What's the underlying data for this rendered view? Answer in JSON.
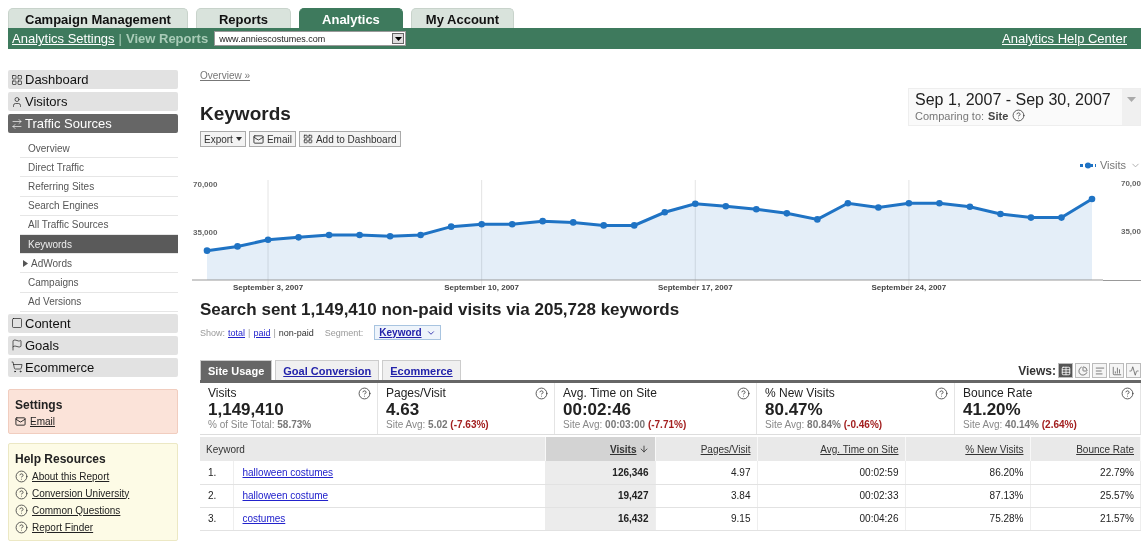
{
  "top_tabs": [
    {
      "label": "Campaign Management",
      "selected": false
    },
    {
      "label": "Reports",
      "selected": false
    },
    {
      "label": "Analytics",
      "selected": true
    },
    {
      "label": "My Account",
      "selected": false
    }
  ],
  "subnav": {
    "settings_link": "Analytics Settings",
    "separator": "|",
    "view_reports": "View Reports",
    "site_select": "www.anniescostumes.com",
    "help_link": "Analytics Help Center"
  },
  "sidebar": {
    "sections": [
      {
        "label": "Dashboard",
        "selected": false
      },
      {
        "label": "Visitors",
        "selected": false
      },
      {
        "label": "Traffic Sources",
        "selected": true,
        "children": [
          {
            "label": "Overview",
            "selected": false,
            "kind": "link"
          },
          {
            "label": "Direct Traffic",
            "selected": false,
            "kind": "link"
          },
          {
            "label": "Referring Sites",
            "selected": false,
            "kind": "link"
          },
          {
            "label": "Search Engines",
            "selected": false,
            "kind": "link"
          },
          {
            "label": "All Traffic Sources",
            "selected": false,
            "kind": "link"
          },
          {
            "label": "Keywords",
            "selected": true,
            "kind": "link"
          },
          {
            "label": "AdWords",
            "selected": false,
            "kind": "group"
          },
          {
            "label": "Campaigns",
            "selected": false,
            "kind": "link"
          },
          {
            "label": "Ad Versions",
            "selected": false,
            "kind": "link"
          }
        ]
      },
      {
        "label": "Content",
        "selected": false
      },
      {
        "label": "Goals",
        "selected": false
      },
      {
        "label": "Ecommerce",
        "selected": false
      }
    ],
    "settings_box": {
      "title": "Settings",
      "links": [
        "Email"
      ]
    },
    "help_box": {
      "title": "Help Resources",
      "links": [
        "About this Report",
        "Conversion University",
        "Common Questions",
        "Report Finder"
      ]
    }
  },
  "main": {
    "breadcrumb": "Overview »",
    "title": "Keywords",
    "actions": [
      {
        "label": "Export",
        "kind": "menu"
      },
      {
        "label": "Email",
        "kind": "email"
      },
      {
        "label": "Add to Dashboard",
        "kind": "dashboard"
      }
    ],
    "date_range": {
      "range": "Sep 1, 2007 - Sep 30, 2007",
      "comparing_label": "Comparing to:",
      "comparing_value": "Site"
    },
    "chart": {
      "right_tick_labels": [
        "70,00",
        "35,00"
      ],
      "chart_data": {
        "type": "area",
        "categories": [
          null,
          null,
          "September 3, 2007",
          null,
          null,
          null,
          null,
          null,
          null,
          "September 10, 2007",
          null,
          null,
          null,
          null,
          null,
          null,
          "September 17, 2007",
          null,
          null,
          null,
          null,
          null,
          null,
          "September 24, 2007",
          null,
          null,
          null,
          null,
          null,
          null
        ],
        "series": [
          {
            "name": "Visits",
            "color": "#1f73c4",
            "values": [
              21400,
              24500,
              29300,
              31100,
              32800,
              32800,
              31900,
              32800,
              38900,
              40700,
              40700,
              42900,
              42000,
              39800,
              39800,
              49400,
              55600,
              53800,
              51600,
              48600,
              44200,
              56000,
              52900,
              56000,
              56000,
              53400,
              48100,
              45500,
              45500,
              59100
            ]
          }
        ],
        "ylim": [
          0,
          70000
        ],
        "grid": true,
        "yticks": [
          {
            "value": 35000,
            "label": "35,000"
          },
          {
            "value": 70000,
            "label": "70,000"
          }
        ]
      }
    },
    "headline": "Search sent 1,149,410 non-paid visits via 205,728 keywords",
    "show": {
      "label": "Show:",
      "separator": "|",
      "options": [
        {
          "label": "total",
          "selected": false
        },
        {
          "label": "paid",
          "selected": false
        },
        {
          "label": "non-paid",
          "selected": true
        }
      ]
    },
    "segment": {
      "label": "Segment:",
      "value": "Keyword"
    },
    "report_tabs": [
      {
        "label": "Site Usage",
        "selected": true
      },
      {
        "label": "Goal Conversion",
        "selected": false
      },
      {
        "label": "Ecommerce",
        "selected": false
      }
    ],
    "views": {
      "label": "Views:",
      "options": [
        {
          "selected": true
        },
        {
          "selected": false
        },
        {
          "selected": false
        },
        {
          "selected": false
        },
        {
          "selected": false
        }
      ]
    },
    "metrics": [
      {
        "name": "Visits",
        "value": "1,149,410",
        "note_label": "% of Site Total:",
        "note_value": "58.73%"
      },
      {
        "name": "Pages/Visit",
        "value": "4.63",
        "note_label": "Site Avg:",
        "note_value": "5.02",
        "delta": "(-7.63%)"
      },
      {
        "name": "Avg. Time on Site",
        "value": "00:02:46",
        "note_label": "Site Avg:",
        "note_value": "00:03:00",
        "delta": "(-7.71%)"
      },
      {
        "name": "% New Visits",
        "value": "80.47%",
        "note_label": "Site Avg:",
        "note_value": "80.84%",
        "delta": "(-0.46%)"
      },
      {
        "name": "Bounce Rate",
        "value": "41.20%",
        "note_label": "Site Avg:",
        "note_value": "40.14%",
        "delta": "(2.64%)"
      }
    ],
    "table": {
      "columns": [
        {
          "label": "Keyword",
          "sorted": false
        },
        {
          "label": "Visits",
          "sorted": true
        },
        {
          "label": "Pages/Visit",
          "sorted": false
        },
        {
          "label": "Avg. Time on Site",
          "sorted": false
        },
        {
          "label": "% New Visits",
          "sorted": false
        },
        {
          "label": "Bounce Rate",
          "sorted": false
        }
      ],
      "rows": [
        {
          "rank": "1.",
          "cells": [
            "halloween costumes",
            "126,346",
            "4.97",
            "00:02:59",
            "86.20%",
            "22.79%"
          ]
        },
        {
          "rank": "2.",
          "cells": [
            "halloween costume",
            "19,427",
            "3.84",
            "00:02:33",
            "87.13%",
            "25.57%"
          ]
        },
        {
          "rank": "3.",
          "cells": [
            "costumes",
            "16,432",
            "9.15",
            "00:04:26",
            "75.28%",
            "21.57%"
          ]
        }
      ]
    }
  }
}
